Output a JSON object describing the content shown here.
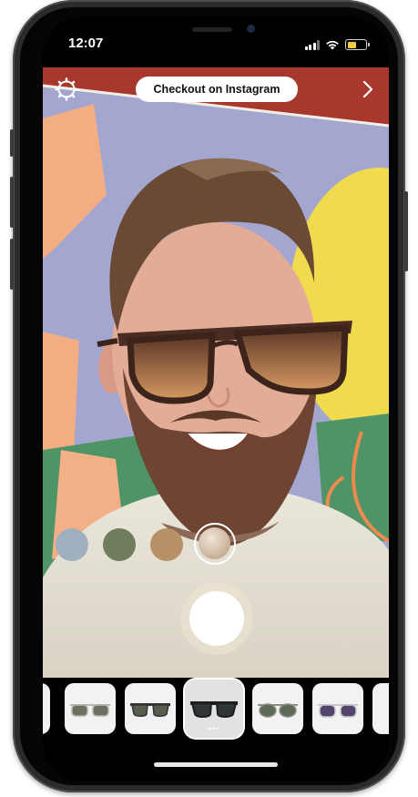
{
  "status_bar": {
    "time": "12:07"
  },
  "header": {
    "checkout_label": "Checkout on Instagram"
  },
  "swatches": [
    {
      "name": "light-blue",
      "color": "#9eb0c0"
    },
    {
      "name": "olive-green",
      "color": "#6f7d5c"
    },
    {
      "name": "tan",
      "color": "#b89266"
    },
    {
      "name": "beige-gradient",
      "color": "#d8c4ac",
      "selected": true
    }
  ],
  "tray": {
    "items": [
      {
        "lens": "#6d6f62",
        "frame": "#b9b7ad",
        "selected": false
      },
      {
        "lens": "#565e4e",
        "frame": "#333333",
        "selected": false
      },
      {
        "lens": "#2f3436",
        "frame": "#1e1e1e",
        "selected": true
      },
      {
        "lens": "#5d6a58",
        "frame": "#8d8d85",
        "selected": false
      },
      {
        "lens": "#54456e",
        "frame": "#d8d8d8",
        "selected": false
      }
    ],
    "dots": "•••"
  },
  "colors": {
    "accent": "#ffffff",
    "battery": "#f7c93b",
    "tray_bg": "#000000"
  }
}
